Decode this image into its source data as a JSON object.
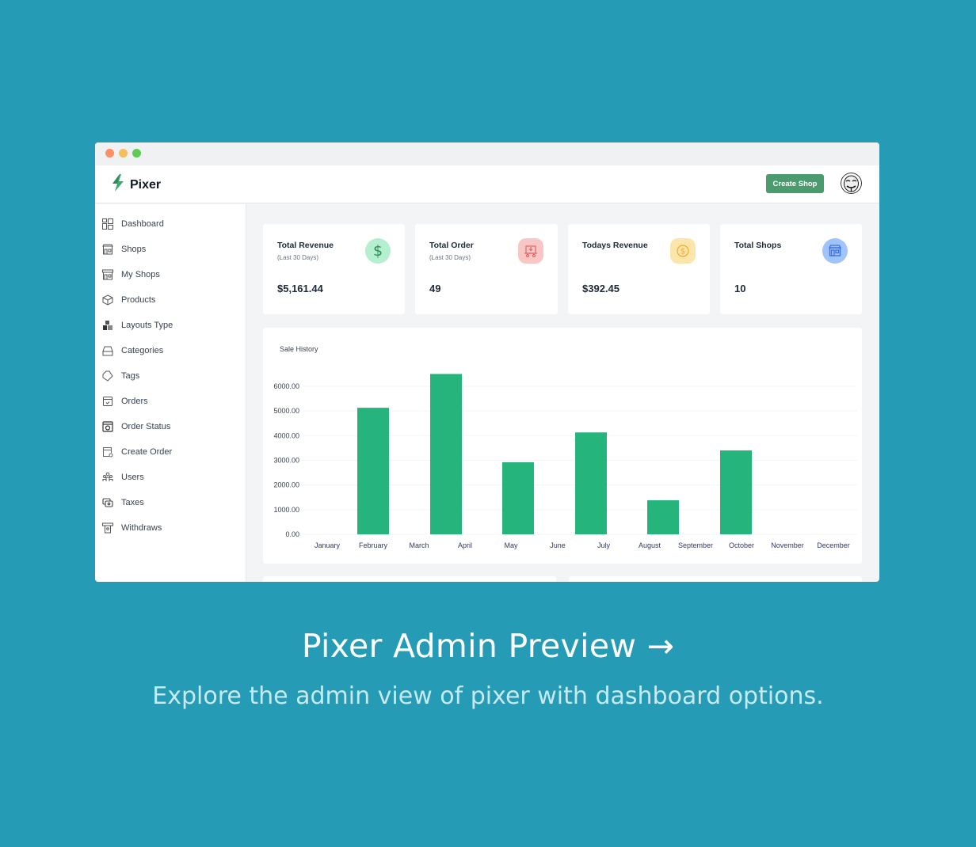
{
  "window": {
    "app_name": "Pixer",
    "create_shop_label": "Create Shop"
  },
  "sidebar": {
    "items": [
      {
        "label": "Dashboard",
        "icon": "dashboard-icon"
      },
      {
        "label": "Shops",
        "icon": "shop-icon"
      },
      {
        "label": "My Shops",
        "icon": "my-shops-icon"
      },
      {
        "label": "Products",
        "icon": "box-icon"
      },
      {
        "label": "Layouts Type",
        "icon": "layouts-icon"
      },
      {
        "label": "Categories",
        "icon": "categories-icon"
      },
      {
        "label": "Tags",
        "icon": "tag-icon"
      },
      {
        "label": "Orders",
        "icon": "orders-icon"
      },
      {
        "label": "Order Status",
        "icon": "order-status-icon"
      },
      {
        "label": "Create Order",
        "icon": "create-order-icon"
      },
      {
        "label": "Users",
        "icon": "users-icon"
      },
      {
        "label": "Taxes",
        "icon": "taxes-icon"
      },
      {
        "label": "Withdraws",
        "icon": "withdraws-icon"
      }
    ]
  },
  "stats": [
    {
      "title": "Total Revenue",
      "subtitle": "(Last 30 Days)",
      "value": "$5,161.44",
      "icon": "dollar-icon",
      "color": "#b4efcf"
    },
    {
      "title": "Total Order",
      "subtitle": "(Last 30 Days)",
      "value": "49",
      "icon": "cart-icon",
      "color": "#f9c6c6"
    },
    {
      "title": "Todays Revenue",
      "subtitle": "",
      "value": "$392.45",
      "icon": "coin-icon",
      "color": "#fce5aa"
    },
    {
      "title": "Total Shops",
      "subtitle": "",
      "value": "10",
      "icon": "store-icon",
      "color": "#9ec4fb"
    }
  ],
  "chart_data": {
    "type": "bar",
    "title": "Sale History",
    "xlabel": "",
    "ylabel": "",
    "categories": [
      "January",
      "February",
      "March",
      "April",
      "May",
      "June",
      "July",
      "August",
      "September",
      "October",
      "November",
      "December"
    ],
    "values": [
      0,
      5130,
      6500,
      0,
      2920,
      0,
      4130,
      1380,
      0,
      3400,
      0,
      0
    ],
    "yticks": [
      "0.00",
      "1000.00",
      "2000.00",
      "3000.00",
      "4000.00",
      "5000.00",
      "6000.00"
    ],
    "ylim": [
      0,
      6000
    ],
    "grid": true,
    "color": "#26b47d"
  },
  "caption": {
    "headline": "Pixer Admin Preview →",
    "subline": "Explore the admin view of pixer with dashboard options."
  }
}
